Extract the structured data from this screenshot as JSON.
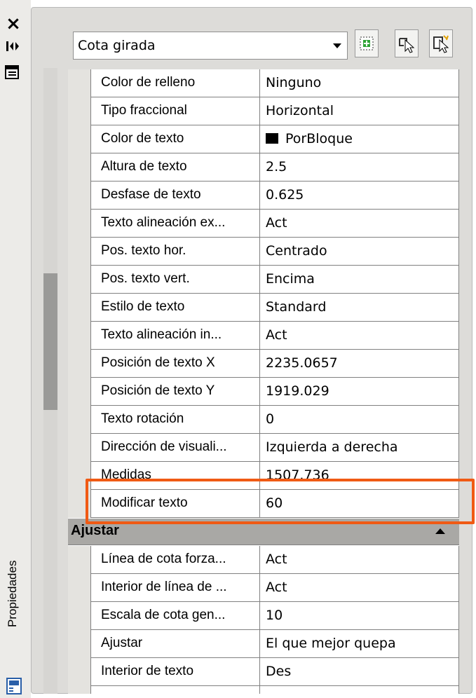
{
  "palette": {
    "panel_bg": "#dddcd9",
    "category_bg": "#a9a8a5",
    "highlight": "#f05a14",
    "swatch_color": "#000000"
  },
  "titlebar": {
    "close_glyph": "×",
    "vertical_title": "Propiedades"
  },
  "selector": {
    "value": "Cota girada"
  },
  "toolbar": {
    "buttons": [
      "quick-select-icon",
      "select-objects-icon",
      "toggle-pickadd-icon"
    ]
  },
  "properties": [
    {
      "label": "Color de relleno",
      "value": "Ninguno"
    },
    {
      "label": "Tipo fraccional",
      "value": "Horizontal"
    },
    {
      "label": "Color de texto",
      "value": "PorBloque",
      "swatch": true
    },
    {
      "label": "Altura de texto",
      "value": "2.5"
    },
    {
      "label": "Desfase de texto",
      "value": "0.625"
    },
    {
      "label": "Texto alineación ex...",
      "value": "Act"
    },
    {
      "label": "Pos. texto hor.",
      "value": "Centrado"
    },
    {
      "label": "Pos. texto vert.",
      "value": "Encima"
    },
    {
      "label": "Estilo de texto",
      "value": "Standard"
    },
    {
      "label": "Texto alineación in...",
      "value": "Act"
    },
    {
      "label": "Posición de texto X",
      "value": "2235.0657"
    },
    {
      "label": "Posición de texto Y",
      "value": "1919.029"
    },
    {
      "label": "Texto rotación",
      "value": "0"
    },
    {
      "label": "Dirección de visuali...",
      "value": "Izquierda a derecha"
    },
    {
      "label": "Medidas",
      "value": "1507.736"
    },
    {
      "label": "Modificar texto",
      "value": "60"
    }
  ],
  "category_fit": {
    "label": "Ajustar",
    "properties": [
      {
        "label": "Línea de cota forza...",
        "value": "Act"
      },
      {
        "label": "Interior de línea de ...",
        "value": "Act"
      },
      {
        "label": "Escala de cota gen...",
        "value": "10"
      },
      {
        "label": "Ajustar",
        "value": "El que mejor quepa"
      },
      {
        "label": "Interior de texto",
        "value": "Des"
      }
    ]
  }
}
